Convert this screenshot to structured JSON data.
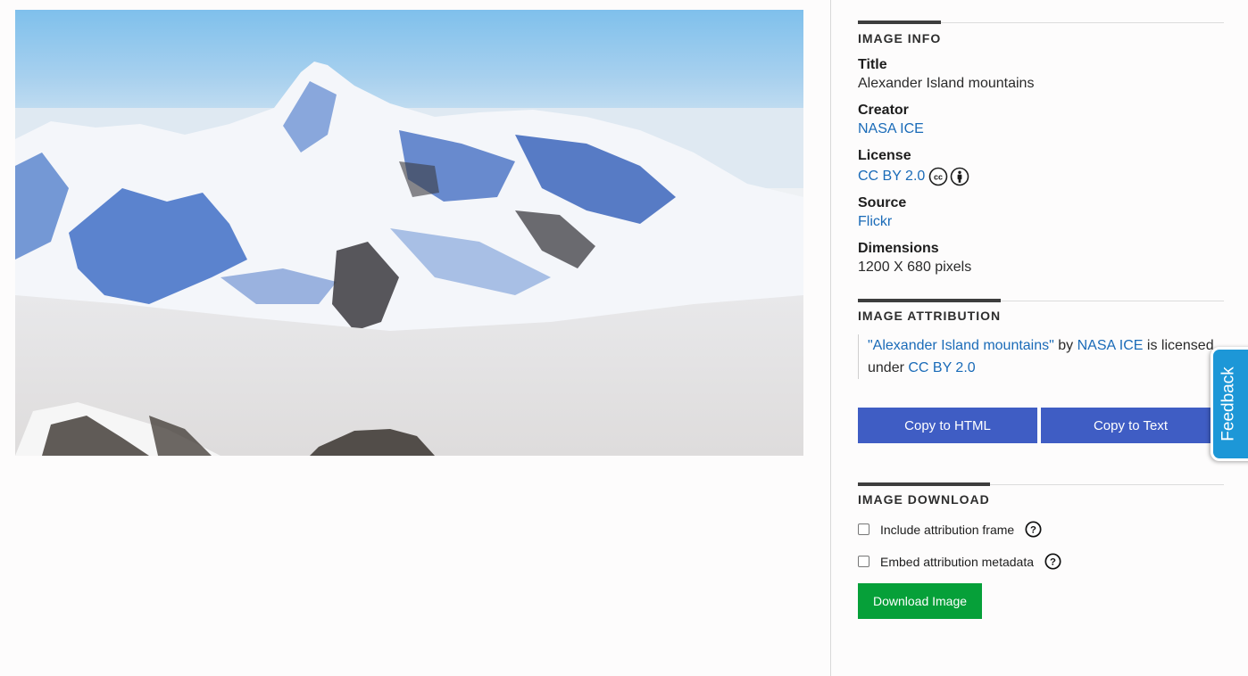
{
  "image": {
    "alt": "Alexander Island mountains"
  },
  "info": {
    "section_title": "IMAGE INFO",
    "title_label": "Title",
    "title_value": "Alexander Island mountains",
    "creator_label": "Creator",
    "creator_value": "NASA ICE",
    "license_label": "License",
    "license_value": "CC BY 2.0",
    "license_icons": [
      "cc-icon",
      "by-person-icon"
    ],
    "source_label": "Source",
    "source_value": "Flickr",
    "dimensions_label": "Dimensions",
    "dimensions_value": "1200 X 680 pixels"
  },
  "attribution": {
    "section_title": "IMAGE ATTRIBUTION",
    "quoted_title": "\"Alexander Island mountains\"",
    "by": "by",
    "creator": "NASA ICE",
    "licensed_under": "is licensed under",
    "license": "CC BY 2.0",
    "copy_html_label": "Copy to HTML",
    "copy_text_label": "Copy to Text"
  },
  "download": {
    "section_title": "IMAGE DOWNLOAD",
    "include_frame_label": "Include attribution frame",
    "embed_metadata_label": "Embed attribution metadata",
    "download_label": "Download Image"
  },
  "feedback": {
    "label": "Feedback"
  },
  "colors": {
    "link": "#1a6bb8",
    "primary_button": "#3f5dc4",
    "download_button": "#06a039",
    "feedback_tab": "#1d97d7"
  }
}
